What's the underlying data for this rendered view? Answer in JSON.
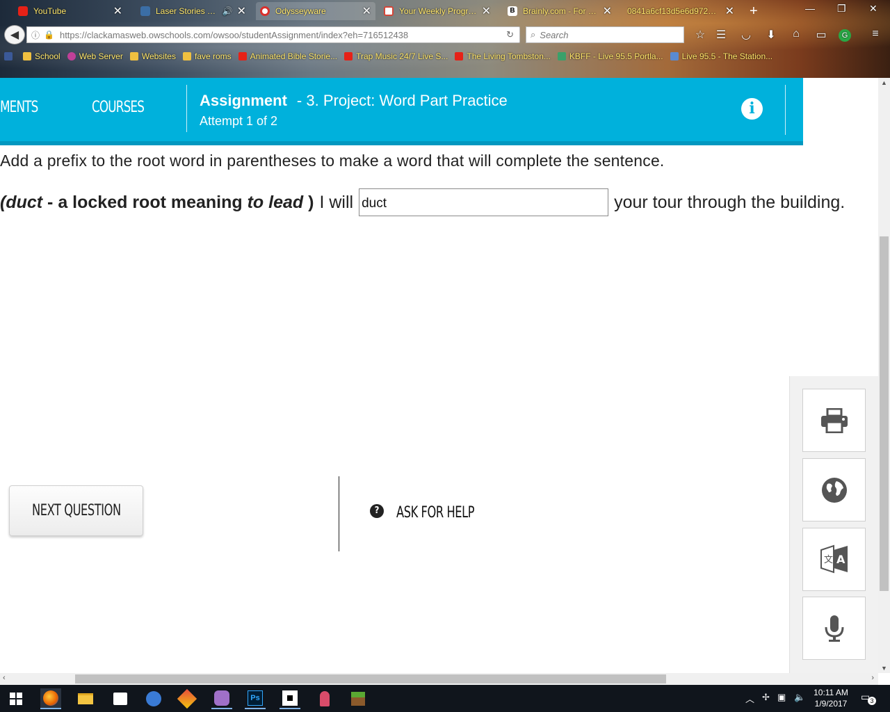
{
  "browser": {
    "tabs": [
      {
        "label": "YouTube",
        "color": "#e62117"
      },
      {
        "label": "Laser Stories - L...",
        "color": "#3b6ea5"
      },
      {
        "label": "Odysseyware",
        "color": "#d9302c"
      },
      {
        "label": "Your Weekly Progre...",
        "color": "#d44638"
      },
      {
        "label": "Brainly.com - For st...",
        "color": "#222222"
      },
      {
        "label": "0841a6cf13d5e6d972673...",
        "color": "#888888"
      }
    ],
    "new_tab": "+",
    "url": "https://clackamasweb.owschools.com/owsoo/studentAssignment/index?eh=716512438",
    "search_placeholder": "Search",
    "bookmarks": [
      {
        "label": "School",
        "color": "#f0c040"
      },
      {
        "label": "Web Server",
        "color": "#c04098"
      },
      {
        "label": "Websites",
        "color": "#f0c040"
      },
      {
        "label": "fave roms",
        "color": "#f0c040"
      },
      {
        "label": "Animated Bible Storie...",
        "color": "#e62117"
      },
      {
        "label": "Trap Music 24/7 Live S...",
        "color": "#e62117"
      },
      {
        "label": "The Living Tombston...",
        "color": "#e62117"
      },
      {
        "label": "KBFF - Live 95.5 Portla...",
        "color": "#3aa06a"
      },
      {
        "label": "Live 95.5 - The Station...",
        "color": "#5a8ad0"
      }
    ]
  },
  "header": {
    "nav_assignments": "MENTS",
    "nav_courses": "COURSES",
    "assignment_label": "Assignment",
    "assignment_title": "- 3. Project: Word Part Practice",
    "attempt": "Attempt 1 of 2",
    "accent": "#00b1dc"
  },
  "question": {
    "instruction": "Add a prefix to the root word in parentheses to make a word that will complete the sentence.",
    "hint_open": "(",
    "hint_root": "duct",
    "hint_mid": " - a locked root meaning ",
    "hint_meaning": "to lead",
    "hint_close": " )",
    "lead_text": "I will",
    "answer_value": "duct",
    "trail_text": "your tour through the building."
  },
  "actions": {
    "next": "NEXT QUESTION",
    "help": "ASK FOR HELP"
  },
  "taskbar": {
    "time": "10:11 AM",
    "date": "1/9/2017",
    "notifications": "3"
  }
}
